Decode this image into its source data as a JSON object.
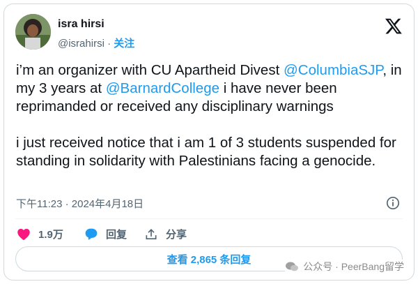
{
  "user": {
    "display_name": "isra hirsi",
    "handle": "@israhirsi",
    "separator": "·",
    "follow_label": "关注"
  },
  "tweet": {
    "paragraph1_a": "i’m an organizer with CU Apartheid Divest ",
    "mention1": "@ColumbiaSJP",
    "paragraph1_b": ", in my 3 years at ",
    "mention2": "@BarnardCollege",
    "paragraph1_c": " i have never been reprimanded or received any disciplinary warnings",
    "paragraph2": "i just received notice that i am 1 of 3 students suspended for standing in solidarity with Palestinians facing a genocide."
  },
  "meta": {
    "timestamp": "下午11:23 · 2024年4月18日"
  },
  "actions": {
    "likes": "1.9万",
    "reply_label": "回复",
    "share_label": "分享"
  },
  "replies_button": {
    "label": "查看 2,865 条回复"
  },
  "watermark": {
    "text": "公众号 · PeerBang留学"
  },
  "icons": {
    "like": "heart-icon",
    "reply": "speech-bubble-icon",
    "share": "share-upload-icon",
    "info": "info-icon",
    "logo": "x-logo-icon"
  },
  "colors": {
    "accent": "#1d9bf0",
    "like": "#f91880",
    "text": "#0f1419",
    "secondary": "#536471"
  }
}
